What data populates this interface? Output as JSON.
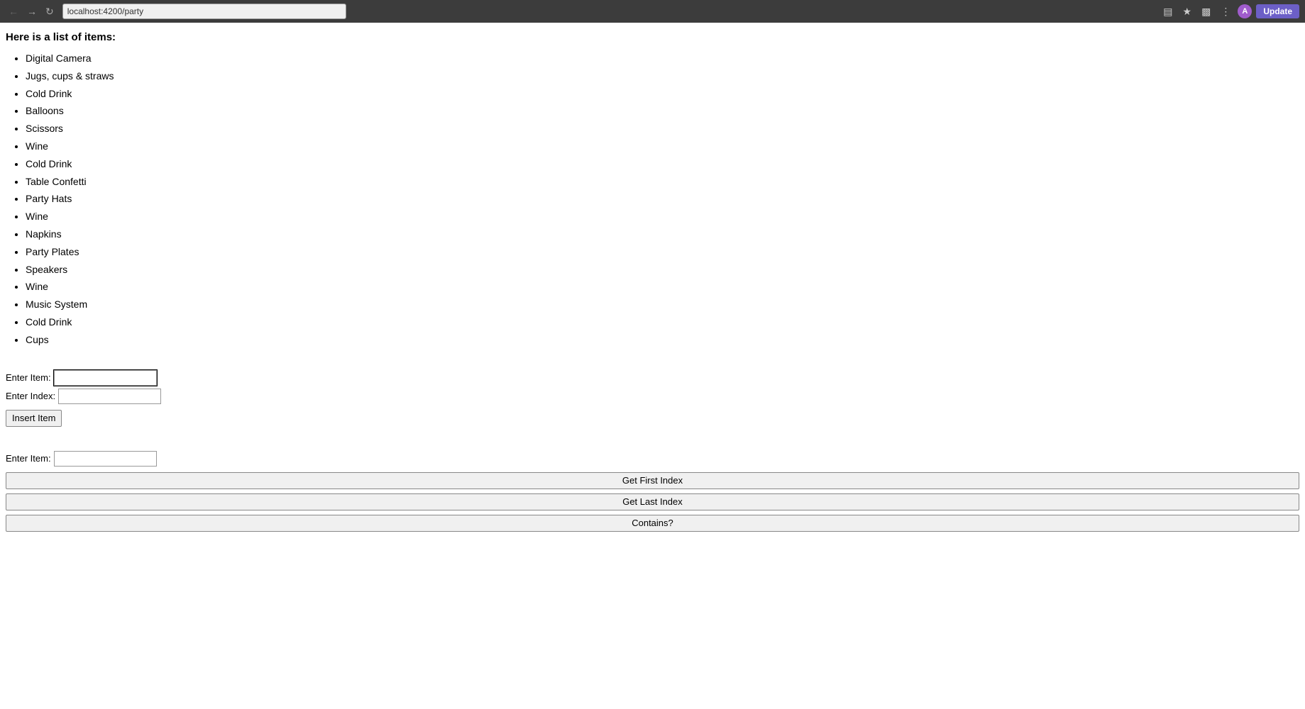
{
  "browser": {
    "url": "localhost:4200/party",
    "update_label": "Update",
    "avatar_letter": "A"
  },
  "page": {
    "heading": "Here is a list of items:",
    "items": [
      "Digital Camera",
      "Jugs, cups & straws",
      "Cold Drink",
      "Balloons",
      "Scissors",
      "Wine",
      "Cold Drink",
      "Table Confetti",
      "Party Hats",
      "Wine",
      "Napkins",
      "Party Plates",
      "Speakers",
      "Wine",
      "Music System",
      "Cold Drink",
      "Cups"
    ]
  },
  "insert_section": {
    "enter_item_label": "Enter Item:",
    "enter_index_label": "Enter Index:",
    "insert_btn_label": "Insert Item",
    "item_placeholder": "",
    "index_placeholder": ""
  },
  "search_section": {
    "enter_item_label": "Enter Item:",
    "item_placeholder": "",
    "get_first_index_label": "Get First Index",
    "get_last_index_label": "Get Last Index",
    "contains_label": "Contains?"
  }
}
